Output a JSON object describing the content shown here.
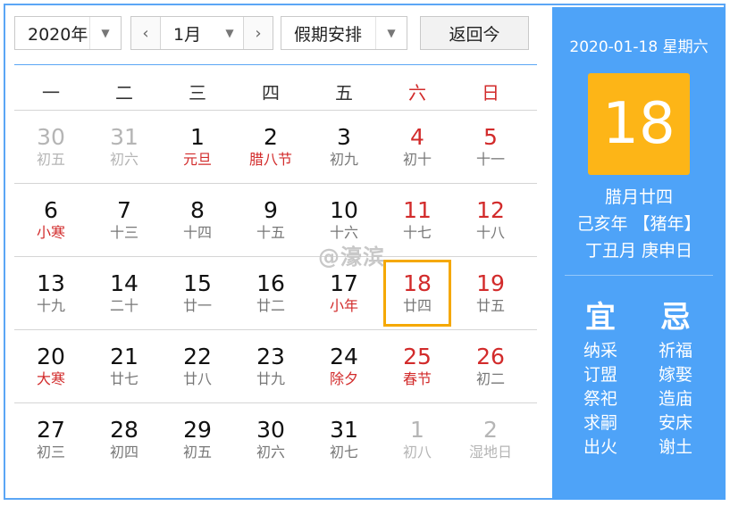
{
  "toolbar": {
    "year": "2020年",
    "month": "1月",
    "prev_symbol": "‹",
    "next_symbol": "›",
    "holiday": "假期安排",
    "today_label": "返回今",
    "dropdown_symbol": "▼"
  },
  "weekdays": [
    "一",
    "二",
    "三",
    "四",
    "五",
    "六",
    "日"
  ],
  "weeks": [
    [
      {
        "day": "30",
        "lunar": "初五",
        "other": true
      },
      {
        "day": "31",
        "lunar": "初六",
        "other": true
      },
      {
        "day": "1",
        "lunar": "元旦",
        "fest": true
      },
      {
        "day": "2",
        "lunar": "腊八节",
        "fest": true
      },
      {
        "day": "3",
        "lunar": "初九"
      },
      {
        "day": "4",
        "lunar": "初十",
        "weekend": true
      },
      {
        "day": "5",
        "lunar": "十一",
        "weekend": true
      }
    ],
    [
      {
        "day": "6",
        "lunar": "小寒",
        "fest": true
      },
      {
        "day": "7",
        "lunar": "十三"
      },
      {
        "day": "8",
        "lunar": "十四"
      },
      {
        "day": "9",
        "lunar": "十五"
      },
      {
        "day": "10",
        "lunar": "十六"
      },
      {
        "day": "11",
        "lunar": "十七",
        "weekend": true
      },
      {
        "day": "12",
        "lunar": "十八",
        "weekend": true
      }
    ],
    [
      {
        "day": "13",
        "lunar": "十九"
      },
      {
        "day": "14",
        "lunar": "二十"
      },
      {
        "day": "15",
        "lunar": "廿一"
      },
      {
        "day": "16",
        "lunar": "廿二"
      },
      {
        "day": "17",
        "lunar": "小年",
        "fest": true
      },
      {
        "day": "18",
        "lunar": "廿四",
        "weekend": true,
        "selected": true
      },
      {
        "day": "19",
        "lunar": "廿五",
        "weekend": true
      }
    ],
    [
      {
        "day": "20",
        "lunar": "大寒",
        "fest": true
      },
      {
        "day": "21",
        "lunar": "廿七"
      },
      {
        "day": "22",
        "lunar": "廿八"
      },
      {
        "day": "23",
        "lunar": "廿九"
      },
      {
        "day": "24",
        "lunar": "除夕",
        "fest": true
      },
      {
        "day": "25",
        "lunar": "春节",
        "weekend": true,
        "fest": true
      },
      {
        "day": "26",
        "lunar": "初二",
        "weekend": true
      }
    ],
    [
      {
        "day": "27",
        "lunar": "初三"
      },
      {
        "day": "28",
        "lunar": "初四"
      },
      {
        "day": "29",
        "lunar": "初五"
      },
      {
        "day": "30",
        "lunar": "初六"
      },
      {
        "day": "31",
        "lunar": "初七"
      },
      {
        "day": "1",
        "lunar": "初八",
        "other": true
      },
      {
        "day": "2",
        "lunar": "湿地日",
        "other": true
      }
    ]
  ],
  "watermark": "@濠滨",
  "panel": {
    "date_line": "2020-01-18 星期六",
    "big_day": "18",
    "lunar_date": "腊月廿四",
    "year_ganzhi": "己亥年 【猪年】",
    "month_day_ganzhi": "丁丑月 庚申日",
    "yi_title": "宜",
    "ji_title": "忌",
    "yi": [
      "纳采",
      "订盟",
      "祭祀",
      "求嗣",
      "出火"
    ],
    "ji": [
      "祈福",
      "嫁娶",
      "造庙",
      "安床",
      "谢土"
    ]
  },
  "colors": {
    "accent_blue": "#4ea3f8",
    "weekend_red": "#d22b2b",
    "highlight_orange": "#f5a800",
    "big_day_bg": "#fdb517"
  }
}
